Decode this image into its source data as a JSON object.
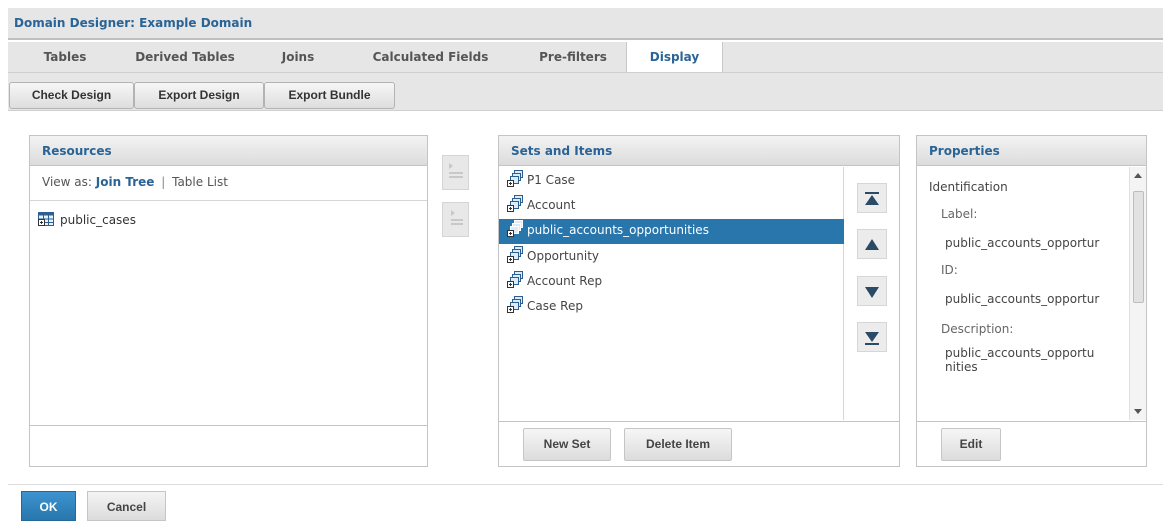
{
  "title": "Domain Designer: Example Domain",
  "tabs": [
    {
      "label": "Tables"
    },
    {
      "label": "Derived Tables"
    },
    {
      "label": "Joins"
    },
    {
      "label": "Calculated Fields"
    },
    {
      "label": "Pre-filters"
    },
    {
      "label": "Display",
      "active": true
    }
  ],
  "toolbar": {
    "check_design": "Check Design",
    "export_design": "Export Design",
    "export_bundle": "Export Bundle"
  },
  "resources": {
    "title": "Resources",
    "view_as_label": "View as:",
    "join_tree": "Join Tree",
    "separator": "|",
    "table_list": "Table List",
    "items": [
      {
        "label": "public_cases",
        "icon": "table-icon"
      }
    ]
  },
  "sets": {
    "title": "Sets and Items",
    "items": [
      {
        "label": "P1 Case",
        "icon": "set-icon"
      },
      {
        "label": "Account",
        "icon": "set-icon"
      },
      {
        "label": "public_accounts_opportunities",
        "icon": "set-icon",
        "selected": true
      },
      {
        "label": "Opportunity",
        "icon": "set-icon"
      },
      {
        "label": "Account Rep",
        "icon": "set-icon"
      },
      {
        "label": "Case Rep",
        "icon": "set-icon"
      }
    ],
    "new_set": "New Set",
    "delete_item": "Delete Item"
  },
  "properties": {
    "title": "Properties",
    "section": "Identification",
    "label_caption": "Label:",
    "label_value": "public_accounts_opportur",
    "id_caption": "ID:",
    "id_value": "public_accounts_opportur",
    "description_caption": "Description:",
    "description_line1": "public_accounts_opportu",
    "description_line2": "nities",
    "edit": "Edit"
  },
  "footer": {
    "ok": "OK",
    "cancel": "Cancel"
  },
  "colors": {
    "accent": "#2a6496",
    "selection": "#2876ac",
    "ok_button": "#2876ac"
  }
}
